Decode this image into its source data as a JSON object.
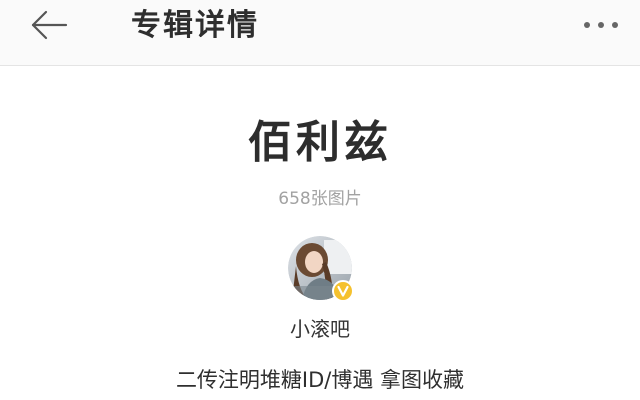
{
  "header": {
    "title": "专辑详情",
    "back_icon": "arrow-left-icon",
    "more_icon": "more-dots-icon"
  },
  "album": {
    "title": "佰利兹",
    "image_count": "658张图片"
  },
  "author": {
    "avatar_icon": "user-avatar",
    "badge_icon": "verified-v-icon",
    "badge_color": "#f5c12e",
    "name": "小滚吧"
  },
  "description": "二传注明堆糖ID/博遇 拿图收藏"
}
